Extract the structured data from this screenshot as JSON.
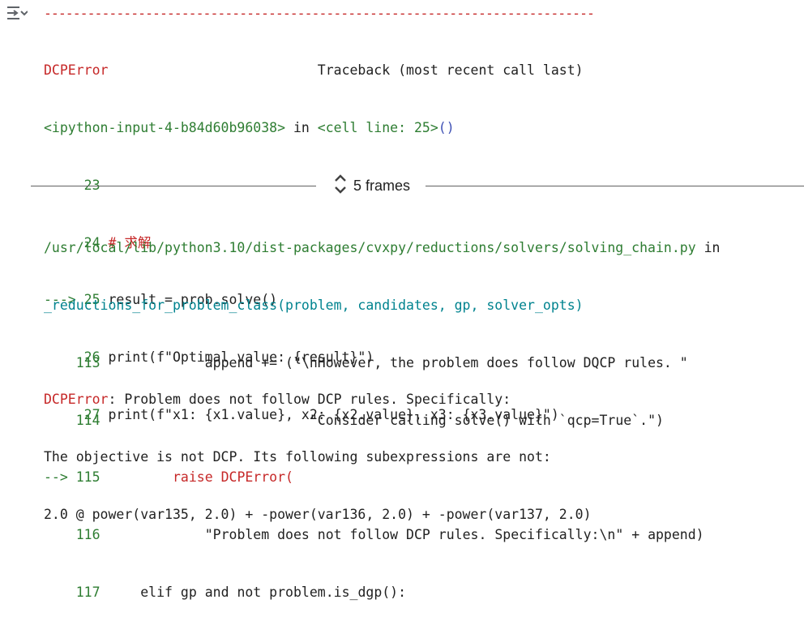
{
  "separator": "----------------------------------------------------------------------------",
  "traceback": {
    "error_type": "DCPError",
    "header_right": "Traceback (most recent call last)",
    "location": {
      "input_ref": "<ipython-input-4-b84d60b96038>",
      "in_word": " in ",
      "cell_ref": "<cell line: 25>",
      "call_parens": "()"
    },
    "lines": [
      {
        "prefix": "     ",
        "num": "23",
        "code": ""
      },
      {
        "prefix": "     ",
        "num": "24",
        "code": " # 求解"
      },
      {
        "prefix": "---> ",
        "num": "25",
        "code": " result = prob.solve()"
      },
      {
        "prefix": "     ",
        "num": "26",
        "code": " print(f\"Optimal value: {result}\")"
      },
      {
        "prefix": "     ",
        "num": "27",
        "code": " print(f\"x1: {x1.value}, x2: {x2.value}, x3: {x3.value}\")"
      }
    ]
  },
  "frames": {
    "label": "5 frames",
    "icon": "unfold-icon"
  },
  "frame2": {
    "path": "/usr/local/lib/python3.10/dist-packages/cvxpy/reductions/solvers/solving_chain.py",
    "in_word": " in",
    "func": "_reductions_for_problem_class(problem, candidates, gp, solver_opts)",
    "lines": [
      {
        "prefix": "    ",
        "num": "113",
        "code": "             append += (\"\\nHowever, the problem does follow DQCP rules. \""
      },
      {
        "prefix": "    ",
        "num": "114",
        "code": "                          \"Consider calling solve() with `qcp=True`.\")"
      },
      {
        "prefix": "--> ",
        "num": "115",
        "code": "         raise DCPError("
      },
      {
        "prefix": "    ",
        "num": "116",
        "code": "             \"Problem does not follow DCP rules. Specifically:\\n\" + append)"
      },
      {
        "prefix": "    ",
        "num": "117",
        "code": "     elif gp and not problem.is_dgp():"
      }
    ]
  },
  "error": {
    "type": "DCPError",
    "message_1": ": Problem does not follow DCP rules. Specifically:",
    "message_2": "The objective is not DCP. Its following subexpressions are not:",
    "message_3": "2.0 @ power(var135, 2.0) + -power(var136, 2.0) + -power(var137, 2.0)"
  },
  "colors": {
    "red": "#c62828",
    "green": "#2e7d32",
    "blue": "#3f51b5",
    "cyan": "#00838f"
  }
}
